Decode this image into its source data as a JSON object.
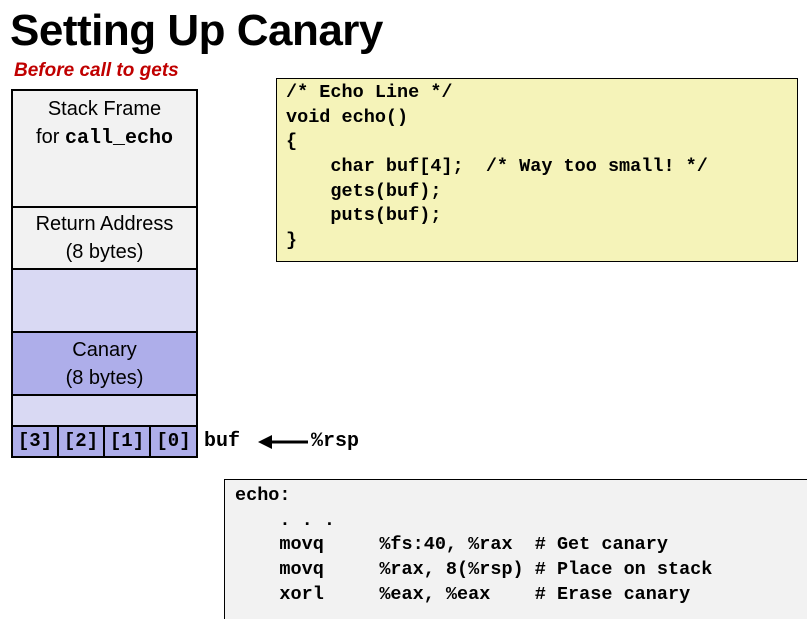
{
  "title": "Setting Up Canary",
  "subtitle": "Before call to gets",
  "stack": {
    "frame_line1": "Stack Frame",
    "frame_for": "for ",
    "frame_func": "call_echo",
    "return_line1": "Return Address",
    "return_line2": "(8 bytes)",
    "canary_line1": "Canary",
    "canary_line2": "(8 bytes)",
    "buf_cells": [
      "[3]",
      "[2]",
      "[1]",
      "[0]"
    ],
    "buf_label": "buf",
    "rsp_label": "%rsp",
    "colors": {
      "frame": "#f2f2f2",
      "empty": "#d9d9f3",
      "canary": "#aeaeea"
    }
  },
  "c_code": {
    "lines": [
      "/* Echo Line */",
      "void echo()",
      "{",
      "    char buf[4];  /* Way too small! */",
      "    gets(buf);",
      "    puts(buf);",
      "}"
    ],
    "background": "#f5f3b9"
  },
  "asm_code": {
    "lines": [
      "echo:",
      "    . . .",
      "    movq     %fs:40, %rax  # Get canary",
      "    movq     %rax, 8(%rsp) # Place on stack",
      "    xorl     %eax, %eax    # Erase canary"
    ],
    "background": "#f2f2f2"
  }
}
